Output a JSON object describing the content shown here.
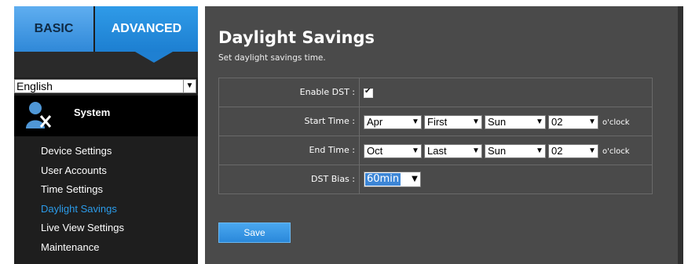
{
  "tabs": {
    "basic": "BASIC",
    "advanced": "ADVANCED"
  },
  "language": {
    "selected": "English"
  },
  "sidebar": {
    "section_title": "System",
    "items": [
      {
        "label": "Device Settings"
      },
      {
        "label": "User Accounts"
      },
      {
        "label": "Time Settings"
      },
      {
        "label": "Daylight Savings",
        "active": true
      },
      {
        "label": "Live View Settings"
      },
      {
        "label": "Maintenance"
      }
    ]
  },
  "page": {
    "title": "Daylight Savings",
    "subtitle": "Set daylight savings time."
  },
  "form": {
    "enable_dst": {
      "label": "Enable DST :",
      "checked": true
    },
    "start_time": {
      "label": "Start Time :",
      "month": "Apr",
      "week": "First",
      "day": "Sun",
      "hour": "02",
      "suffix": "o'clock"
    },
    "end_time": {
      "label": "End Time :",
      "month": "Oct",
      "week": "Last",
      "day": "Sun",
      "hour": "02",
      "suffix": "o'clock"
    },
    "dst_bias": {
      "label": "DST Bias :",
      "value": "60min"
    }
  },
  "buttons": {
    "save": "Save"
  },
  "colors": {
    "accent": "#2b9be9",
    "panel": "#4a4a4a",
    "sidebar": "#1e1e1e"
  }
}
